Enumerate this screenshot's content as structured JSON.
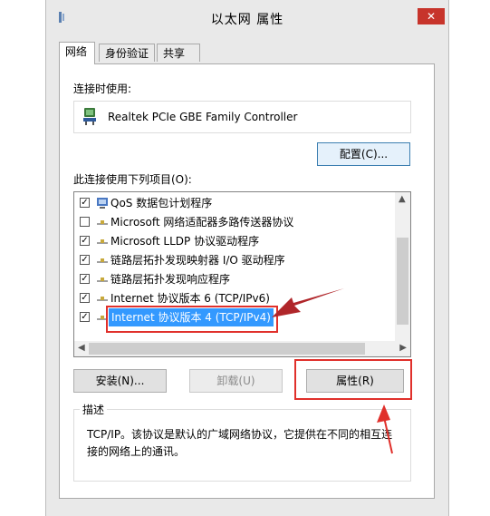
{
  "window": {
    "title": "以太网 属性",
    "close_label": "✕"
  },
  "tabs": [
    {
      "label": "网络"
    },
    {
      "label": "身份验证"
    },
    {
      "label": "共享"
    }
  ],
  "connect_using_label": "连接时使用:",
  "adapter_name": "Realtek PCIe GBE Family Controller",
  "configure_button": "配置(C)...",
  "items_label": "此连接使用下列项目(O):",
  "items": [
    {
      "label": "QoS 数据包计划程序",
      "checked": true,
      "icon": "qos-scheduler-icon"
    },
    {
      "label": "Microsoft 网络适配器多路传送器协议",
      "checked": false,
      "icon": "protocol-icon"
    },
    {
      "label": "Microsoft LLDP 协议驱动程序",
      "checked": true,
      "icon": "protocol-icon"
    },
    {
      "label": "链路层拓扑发现映射器 I/O 驱动程序",
      "checked": true,
      "icon": "protocol-icon"
    },
    {
      "label": "链路层拓扑发现响应程序",
      "checked": true,
      "icon": "protocol-icon"
    },
    {
      "label": "Internet 协议版本 6 (TCP/IPv6)",
      "checked": true,
      "icon": "protocol-icon"
    },
    {
      "label": "Internet 协议版本 4 (TCP/IPv4)",
      "checked": true,
      "icon": "protocol-icon",
      "selected": true
    }
  ],
  "install_button": "安装(N)...",
  "uninstall_button": "卸载(U)",
  "properties_button": "属性(R)",
  "description": {
    "title": "描述",
    "text": "TCP/IP。该协议是默认的广域网络协议，它提供在不同的相互连接的网络上的通讯。"
  },
  "colors": {
    "highlight": "#e0302b",
    "selection": "#3399ff",
    "close": "#c7342b"
  }
}
